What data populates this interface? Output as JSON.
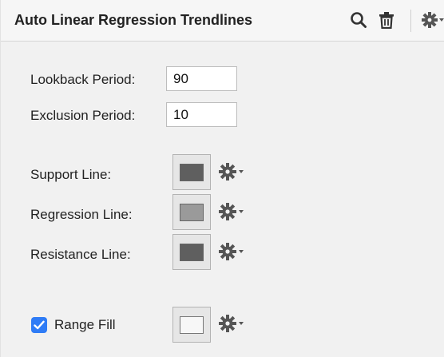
{
  "header": {
    "title": "Auto Linear Regression Trendlines",
    "icons": [
      "search-icon",
      "trash-icon",
      "gear-icon"
    ]
  },
  "settings": {
    "lookback_label": "Lookback Period:",
    "lookback_value": "90",
    "exclusion_label": "Exclusion Period:",
    "exclusion_value": "10"
  },
  "lines": {
    "support": {
      "label": "Support Line:",
      "color": "#5f5f5f"
    },
    "regression": {
      "label": "Regression Line:",
      "color": "#9a9a9a"
    },
    "resistance": {
      "label": "Resistance Line:",
      "color": "#5f5f5f"
    }
  },
  "range_fill": {
    "label": "Range Fill",
    "checked": true,
    "color": "#f7f7f7"
  },
  "colors": {
    "accent": "#2f7cf6",
    "panel_bg": "#f1f1f1"
  }
}
